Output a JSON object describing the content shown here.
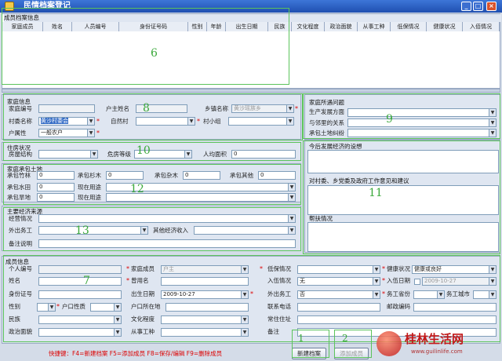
{
  "window": {
    "title": "民情档案登记",
    "min": "_",
    "max": "□",
    "close": "×"
  },
  "archive": {
    "title": "成员档案信息",
    "columns": [
      "家庭成员",
      "姓名",
      "人员编号",
      "身份证号码",
      "性别",
      "年龄",
      "出生日期",
      "民族",
      "文化程度",
      "政治面貌",
      "从事工种",
      "低保情况",
      "健康状况",
      "入佰情况"
    ]
  },
  "family": {
    "title": "家庭信息",
    "code_label": "家庭编号",
    "head_label": "户主姓名",
    "town_label": "乡镇名称",
    "town_value": "黄沙瑶族乡",
    "village_label": "村委名称",
    "village_value": "黄沙村委会",
    "natural_label": "自然村",
    "group_label": "村小组",
    "type_label": "户属性",
    "type_value": "一般农户"
  },
  "problems": {
    "title": "家庭所遇问题",
    "prod_label": "生产发展方面",
    "neigh_label": "与邻里的关系",
    "land_label": "承包土地纠纷"
  },
  "housing": {
    "title": "住房状况",
    "struct_label": "房屋结构",
    "danger_label": "危房等级",
    "area_label": "人均面积",
    "area_value": "0"
  },
  "land": {
    "title": "家庭承包土地",
    "bamboo_label": "承包竹林",
    "bamboo_value": "0",
    "fir_label": "承包杉木",
    "fir_value": "0",
    "misc_label": "承包杂木",
    "misc_value": "0",
    "other_label": "承包其他",
    "other_value": "0",
    "paddy_label": "承包水田",
    "paddy_value": "0",
    "use1_label": "现在用途",
    "dry_label": "承包旱地",
    "dry_value": "0",
    "use2_label": "现在用途"
  },
  "income": {
    "title": "主要经济来源",
    "farm_label": "经营情况",
    "work_label": "外出务工",
    "other_label": "其他经济收入",
    "note_label": "备注说明"
  },
  "plans": {
    "future_title": "今后发展经济的设想",
    "advice_title": "对村委、乡党委及政府工作意见和建议",
    "help_title": "帮扶情况"
  },
  "member": {
    "title": "成员信息",
    "id_label": "个人编号",
    "relation_label": "家庭成员",
    "relation_value": "户主",
    "allowance_label": "低保情况",
    "health_label": "健康状况",
    "health_value": "健康或良好",
    "name_label": "姓名",
    "alias_label": "曾用名",
    "army_label": "入伍情况",
    "army_value": "无",
    "army_date_label": "入伍日期",
    "army_date_value": "2009-10-27",
    "idcard_label": "身份证号",
    "birth_label": "出生日期",
    "birth_value": "2009-10-27",
    "outwork_label": "外出务工",
    "outwork_value": "否",
    "province_label": "务工省份",
    "city_label": "务工城市",
    "gender_label": "性别",
    "hukou_label": "户口性质",
    "hukou_place_label": "户口所在地",
    "phone_label": "联系电话",
    "post_label": "邮政编码",
    "ethnic_label": "民族",
    "edu_label": "文化程度",
    "address_label": "常住住址",
    "political_label": "政治面貌",
    "job_label": "从事工种",
    "remark_label": "备注"
  },
  "footer": {
    "shortcuts": "快捷键：F4=新建档案    F5=添加成员    F8=保存/编辑    F9=删除成员",
    "new_button": "新建档案",
    "add_button": "添加成员",
    "watermark": "桂林生活网",
    "watermark_url": "www.guilinlife.com"
  },
  "annotations": [
    "1",
    "2",
    "6",
    "7",
    "8",
    "9",
    "10",
    "11",
    "12",
    "13"
  ],
  "colors": {
    "title_bar": "#1f4fb0",
    "panel": "#dfe6f1",
    "highlight": "#5cc45c",
    "required": "#dd0000"
  }
}
